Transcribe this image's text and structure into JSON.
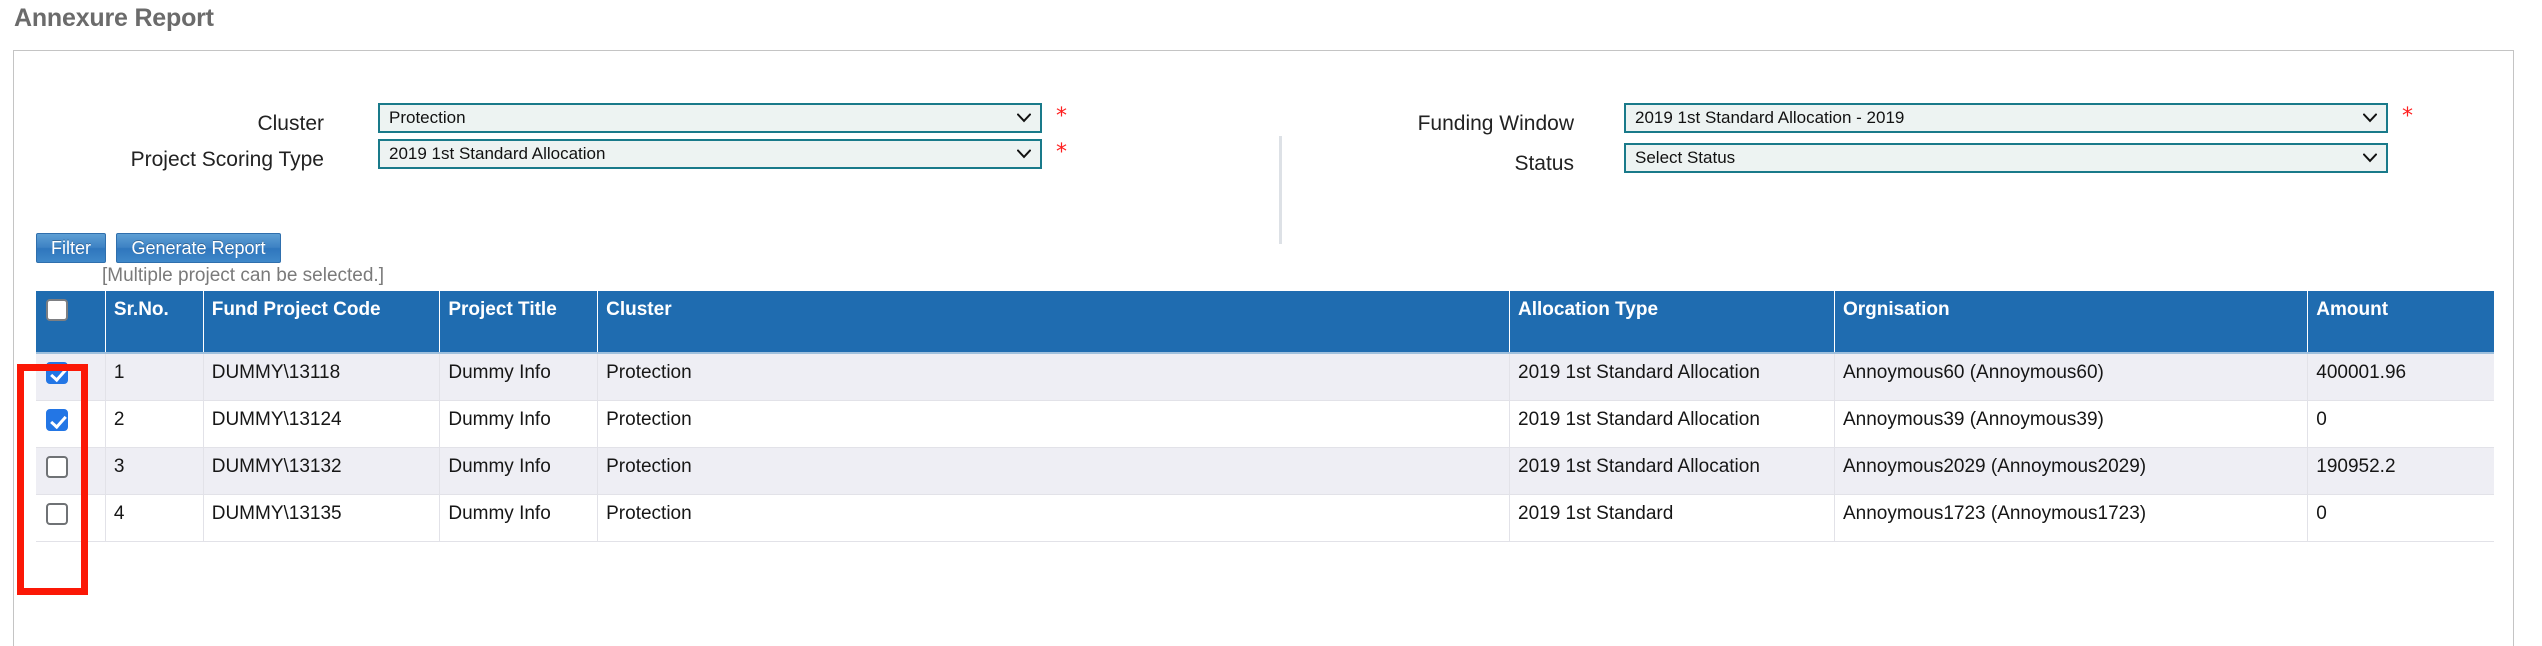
{
  "page": {
    "title": "Annexure Report"
  },
  "form": {
    "fields": [
      {
        "label": "Cluster",
        "value": "Protection",
        "required": true,
        "icon": "chevron-down-icon"
      },
      {
        "label": "Project Scoring Type",
        "value": "2019 1st Standard Allocation",
        "required": true,
        "icon": "chevron-down-icon"
      },
      {
        "label": "Funding Window",
        "value": "2019 1st Standard Allocation - 2019",
        "required": true,
        "icon": "chevron-down-icon"
      },
      {
        "label": "Status",
        "value": "Select Status",
        "required": false,
        "icon": "chevron-down-icon"
      }
    ],
    "required_marker": "*"
  },
  "actions": {
    "filter_label": "Filter",
    "generate_label": "Generate Report",
    "hint": "[Multiple project can be selected.]"
  },
  "table": {
    "columns": [
      "",
      "Sr.No.",
      "Fund Project Code",
      "Project Title",
      "Cluster",
      "Allocation Type",
      "Orgnisation",
      "Amount"
    ],
    "header_select_all_checked": false,
    "rows": [
      {
        "checked": true,
        "srno": "1",
        "code": "DUMMY\\13118",
        "title": "Dummy Info",
        "cluster": "Protection",
        "allocation": "2019 1st Standard Allocation",
        "organisation": "Annoymous60 (Annoymous60)",
        "amount": "400001.96"
      },
      {
        "checked": true,
        "srno": "2",
        "code": "DUMMY\\13124",
        "title": "Dummy Info",
        "cluster": "Protection",
        "allocation": "2019 1st Standard Allocation",
        "organisation": "Annoymous39 (Annoymous39)",
        "amount": "0"
      },
      {
        "checked": false,
        "srno": "3",
        "code": "DUMMY\\13132",
        "title": "Dummy Info",
        "cluster": "Protection",
        "allocation": "2019 1st Standard Allocation",
        "organisation": "Annoymous2029 (Annoymous2029)",
        "amount": "190952.2"
      },
      {
        "checked": false,
        "srno": "4",
        "code": "DUMMY\\13135",
        "title": "Dummy Info",
        "cluster": "Protection",
        "allocation": "2019 1st Standard",
        "organisation": "Annoymous1723 (Annoymous1723)",
        "amount": "0"
      }
    ]
  },
  "annotation": {
    "shape": "rectangle",
    "color": "#fb1806",
    "target": "row-selection-checkbox-column"
  },
  "colors": {
    "header_blue": "#1f6cb0",
    "button_blue": "#3d82c4",
    "select_border_teal": "#197a8a",
    "select_bg": "#edf3f2",
    "required_red": "#ff1f1f",
    "annotation_red": "#fb1806",
    "row_stripe": "#eeeef4"
  }
}
